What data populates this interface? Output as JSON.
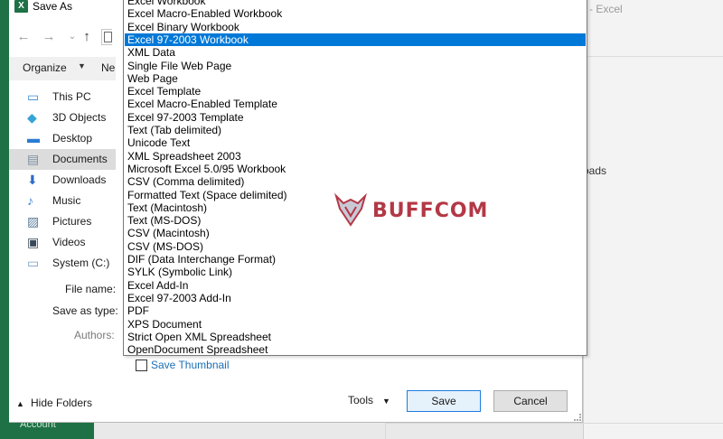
{
  "background": {
    "app_title": "- Excel",
    "right_text": "oads",
    "left_bottom_text": "Account"
  },
  "dialog": {
    "title": "Save As",
    "app_logo_letter": "X",
    "organize_label": "Organize",
    "new_folder_label": "Ne",
    "sidebar": [
      {
        "label": "This PC",
        "icon": "computer-icon",
        "color": "#3a8ad6",
        "selected": false
      },
      {
        "label": "3D Objects",
        "icon": "cube-icon",
        "color": "#35a3d8",
        "selected": false
      },
      {
        "label": "Desktop",
        "icon": "desktop-icon",
        "color": "#2b7bd2",
        "selected": false
      },
      {
        "label": "Documents",
        "icon": "document-icon",
        "color": "#7d8fa3",
        "selected": true
      },
      {
        "label": "Downloads",
        "icon": "download-icon",
        "color": "#2d6cc7",
        "selected": false
      },
      {
        "label": "Music",
        "icon": "music-icon",
        "color": "#3a83d4",
        "selected": false
      },
      {
        "label": "Pictures",
        "icon": "pictures-icon",
        "color": "#5a7b9a",
        "selected": false
      },
      {
        "label": "Videos",
        "icon": "video-icon",
        "color": "#39495a",
        "selected": false
      },
      {
        "label": "System (C:)",
        "icon": "drive-icon",
        "color": "#7aa0c4",
        "selected": false
      }
    ],
    "file_name_label": "File name:",
    "save_as_type_label": "Save as type:",
    "authors_label": "Authors:",
    "save_thumbnail_label": "Save Thumbnail",
    "hide_folders_label": "Hide Folders",
    "tools_label": "Tools",
    "save_label": "Save",
    "cancel_label": "Cancel"
  },
  "file_types": {
    "options": [
      "Excel Workbook",
      "Excel Macro-Enabled Workbook",
      "Excel Binary Workbook",
      "Excel 97-2003 Workbook",
      "XML Data",
      "Single File Web Page",
      "Web Page",
      "Excel Template",
      "Excel Macro-Enabled Template",
      "Excel 97-2003 Template",
      "Text (Tab delimited)",
      "Unicode Text",
      "XML Spreadsheet 2003",
      "Microsoft Excel 5.0/95 Workbook",
      "CSV (Comma delimited)",
      "Formatted Text (Space delimited)",
      "Text (Macintosh)",
      "Text (MS-DOS)",
      "CSV (Macintosh)",
      "CSV (MS-DOS)",
      "DIF (Data Interchange Format)",
      "SYLK (Symbolic Link)",
      "Excel Add-In",
      "Excel 97-2003 Add-In",
      "PDF",
      "XPS Document",
      "Strict Open XML Spreadsheet",
      "OpenDocument Spreadsheet"
    ],
    "selected": "Excel 97-2003 Workbook",
    "selected_color": "#0078d7"
  },
  "watermark": {
    "text": "BUFFCOM"
  }
}
